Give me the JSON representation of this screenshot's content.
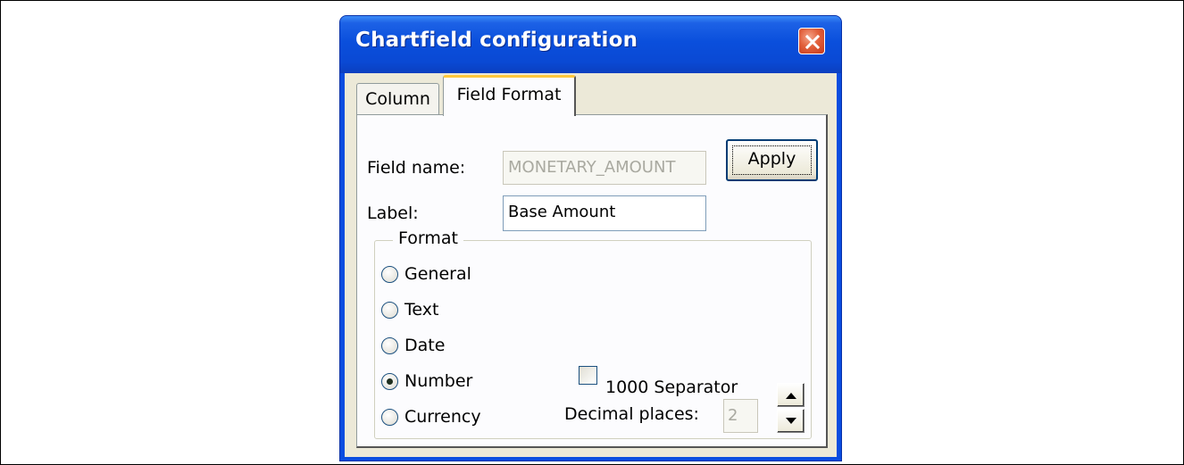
{
  "window": {
    "title": "Chartfield configuration",
    "close_icon": "close-icon"
  },
  "tabs": [
    {
      "label": "Column",
      "active": false
    },
    {
      "label": "Field Format",
      "active": true
    }
  ],
  "form": {
    "field_name_label": "Field name:",
    "field_name_value": "MONETARY_AMOUNT",
    "label_label": "Label:",
    "label_value": "Base Amount",
    "apply_label": "Apply"
  },
  "format_group": {
    "title": "Format",
    "options": [
      {
        "label": "General",
        "checked": false
      },
      {
        "label": "Text",
        "checked": false
      },
      {
        "label": "Date",
        "checked": false
      },
      {
        "label": "Number",
        "checked": true
      },
      {
        "label": "Currency",
        "checked": false
      }
    ],
    "separator_label": "1000 Separator",
    "separator_checked": false,
    "decimal_places_label": "Decimal places:",
    "decimal_places_value": "2"
  },
  "colors": {
    "titlebar": "#0a4fdc",
    "close_button": "#e2603b",
    "dialog_face": "#ece9d8"
  }
}
